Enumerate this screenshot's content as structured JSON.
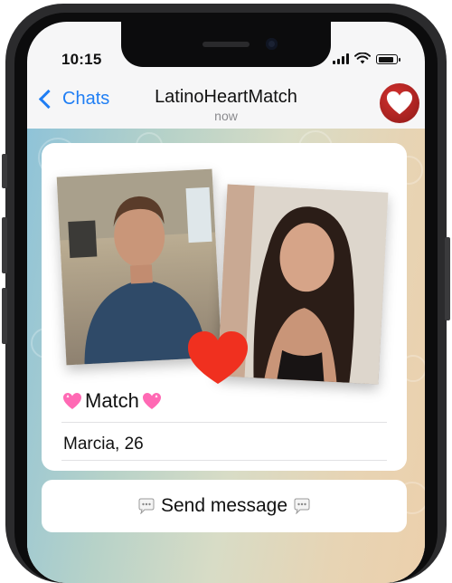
{
  "status_bar": {
    "time": "10:15"
  },
  "nav": {
    "back_label": "Chats",
    "title": "LatinoHeartMatch",
    "subtitle": "now"
  },
  "card": {
    "match_label": "Match",
    "profile_name": "Marcia, 26"
  },
  "actions": {
    "send_message_label": "Send message"
  },
  "colors": {
    "accent": "#1f7ef4",
    "heart": "#f0301f",
    "avatar": "#c0282a"
  },
  "icons": [
    "chevron-left-icon",
    "heart-icon",
    "sparkling-heart-icon",
    "speech-bubble-icon",
    "signal-icon",
    "wifi-icon",
    "battery-icon"
  ]
}
